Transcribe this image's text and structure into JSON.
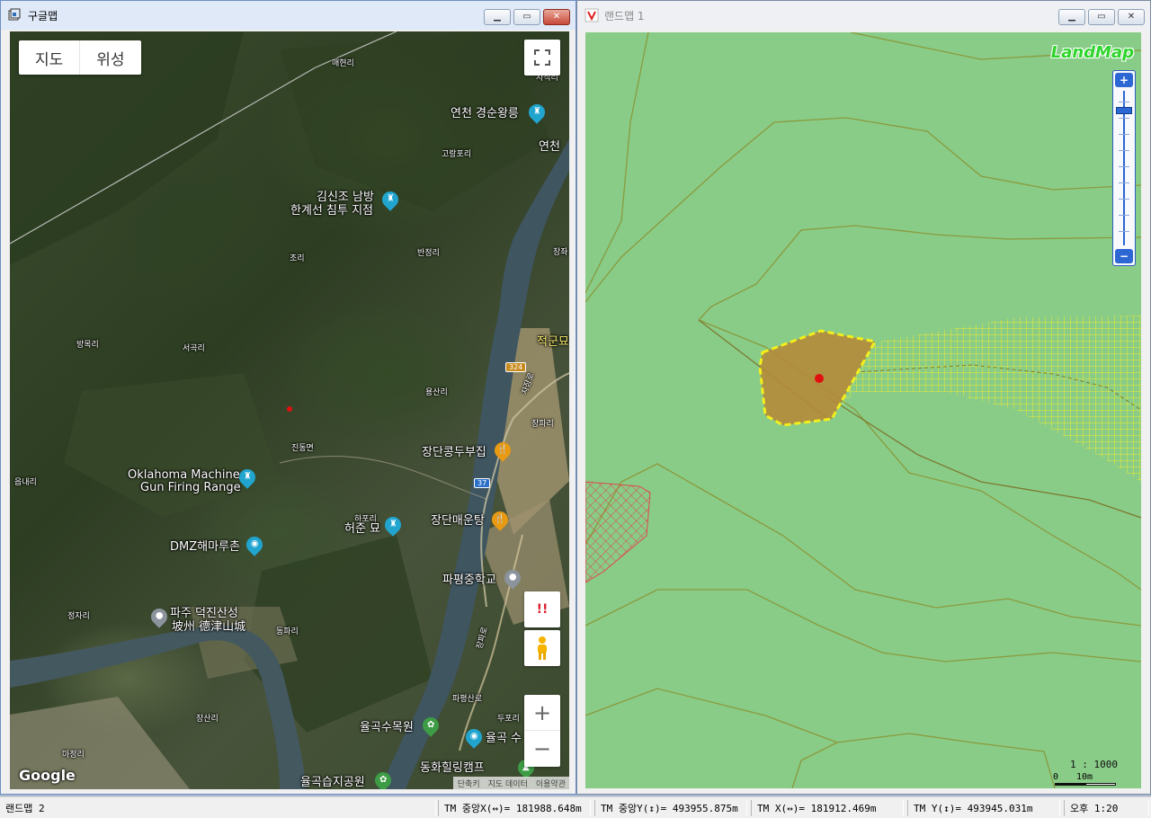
{
  "google_window": {
    "title": "구글맵",
    "map_type": {
      "map": "지도",
      "satellite": "위성"
    },
    "logo": "Google",
    "footer": [
      "단축키",
      "지도 데이터",
      "이용약관"
    ],
    "labels": [
      {
        "text": "매현리",
        "cls": "small"
      },
      {
        "text": "사직리",
        "cls": "small"
      },
      {
        "text": "연천 경순왕릉",
        "cls": "big"
      },
      {
        "text": "고랑포리",
        "cls": "small"
      },
      {
        "text": "연천",
        "cls": "big"
      },
      {
        "text": "김신조 남방",
        "cls": "big"
      },
      {
        "text": "한계선 침투 지점",
        "cls": "big"
      },
      {
        "text": "조리",
        "cls": "small"
      },
      {
        "text": "반정리",
        "cls": "small"
      },
      {
        "text": "장좌",
        "cls": "small"
      },
      {
        "text": "방목리",
        "cls": "small"
      },
      {
        "text": "서곡리",
        "cls": "small"
      },
      {
        "text": "적군묘",
        "cls": "big yellow"
      },
      {
        "text": "용산리",
        "cls": "small"
      },
      {
        "text": "장파리",
        "cls": "small"
      },
      {
        "text": "진동면",
        "cls": "small"
      },
      {
        "text": "장단콩두부집",
        "cls": "big"
      },
      {
        "text": "Oklahoma Machine",
        "cls": "big"
      },
      {
        "text": "Gun Firing Range",
        "cls": "big"
      },
      {
        "text": "읍내리",
        "cls": "small"
      },
      {
        "text": "하포리",
        "cls": "small"
      },
      {
        "text": "허준 묘",
        "cls": "big"
      },
      {
        "text": "장단매운탕",
        "cls": "big"
      },
      {
        "text": "DMZ해마루촌",
        "cls": "big"
      },
      {
        "text": "파평중학교",
        "cls": "big"
      },
      {
        "text": "정자리",
        "cls": "small"
      },
      {
        "text": "파주 덕진산성",
        "cls": "big"
      },
      {
        "text": "坡州 德津山城",
        "cls": "big"
      },
      {
        "text": "동파리",
        "cls": "small"
      },
      {
        "text": "파평산로",
        "cls": "small"
      },
      {
        "text": "장산리",
        "cls": "small"
      },
      {
        "text": "두포리",
        "cls": "small"
      },
      {
        "text": "율곡수목원",
        "cls": "big"
      },
      {
        "text": "율곡 수",
        "cls": "big"
      },
      {
        "text": "마정리",
        "cls": "small"
      },
      {
        "text": "동화힐링캠프",
        "cls": "big"
      },
      {
        "text": "율곡습지공원",
        "cls": "big"
      },
      {
        "text": "자장로",
        "cls": "small"
      },
      {
        "text": "장파로",
        "cls": "small"
      }
    ],
    "road_shields": [
      {
        "text": "324",
        "color": "#c78a1b"
      },
      {
        "text": "37",
        "color": "#2a6fc8"
      }
    ],
    "controls": {
      "fullscreen": "⛶",
      "alert": "!!",
      "zoom_in": "+",
      "zoom_out": "−"
    }
  },
  "landmap_window": {
    "title": "랜드맵 1",
    "logo": "LandMap",
    "scale_text": "1 : 1000",
    "scale_labels": [
      "0",
      "10m"
    ],
    "zoom": {
      "in": "+",
      "out": "−",
      "level": 0.12
    }
  },
  "statusbar": {
    "title": "랜드맵 2",
    "tm_center_x": "TM 중앙X(↔)= 181988.648m",
    "tm_center_y": "TM 중앙Y(↕)= 493955.875m",
    "tm_x": "TM X(↔)= 181912.469m",
    "tm_y": "TM Y(↕)= 493945.031m",
    "time": "오후 1:20"
  },
  "colors": {
    "landmap_green": "#89cc88",
    "parcel_fill": "#b58a3a",
    "parcel_border": "#f2ef1c",
    "hatch_red": "#e05050",
    "marker": "#e01010"
  }
}
